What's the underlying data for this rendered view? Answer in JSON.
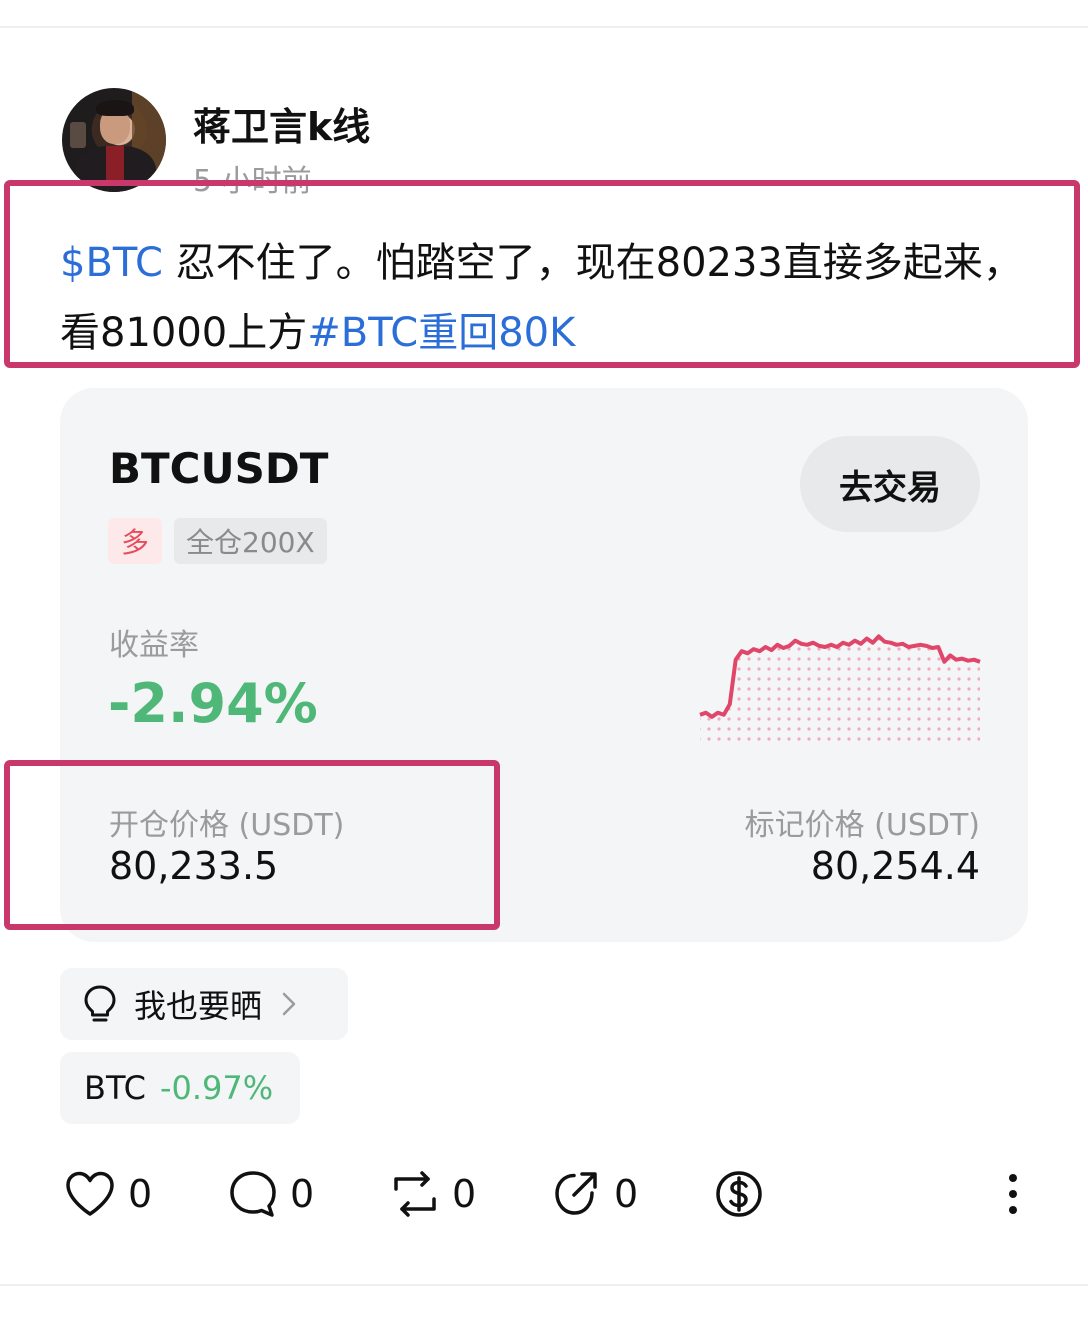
{
  "author": {
    "name": "蒋卫言k线",
    "time_ago": "5 小时前"
  },
  "post": {
    "ticker_link": "$BTC",
    "text": " 忍不住了。怕踏空了，现在80233直接多起来，看81000上方",
    "hashtag": "#BTC重回80K"
  },
  "position_card": {
    "symbol": "BTCUSDT",
    "trade_button": "去交易",
    "side_tag": "多",
    "margin_tag": "全仓200X",
    "roi_label": "收益率",
    "roi_value": "-2.94%",
    "open_price_label": "开仓价格 (USDT)",
    "open_price": "80,233.5",
    "mark_price_label": "标记价格 (USDT)",
    "mark_price": "80,254.4",
    "sparkline_color": "#e0466a",
    "sparkline_values": [
      0.2,
      0.22,
      0.18,
      0.22,
      0.2,
      0.3,
      0.72,
      0.8,
      0.78,
      0.82,
      0.8,
      0.84,
      0.81,
      0.86,
      0.83,
      0.85,
      0.9,
      0.87,
      0.86,
      0.88,
      0.85,
      0.84,
      0.86,
      0.84,
      0.88,
      0.86,
      0.9,
      0.87,
      0.92,
      0.88,
      0.94,
      0.89,
      0.88,
      0.86,
      0.87,
      0.84,
      0.85,
      0.86,
      0.85,
      0.83,
      0.84,
      0.7,
      0.76,
      0.72,
      0.73,
      0.71,
      0.72,
      0.7
    ]
  },
  "share_chip": {
    "icon": "lightbulb-icon",
    "label": "我也要晒"
  },
  "ticker_chip": {
    "symbol": "BTC",
    "change": "-0.97%",
    "change_color": "#4fb879"
  },
  "actions": {
    "likes": "0",
    "comments": "0",
    "reposts": "0",
    "shares": "0"
  },
  "colors": {
    "accent_link": "#2c6ed8",
    "highlight_border": "#c8386a",
    "negative_green": "#4fb879",
    "long_red": "#e44d5d"
  }
}
